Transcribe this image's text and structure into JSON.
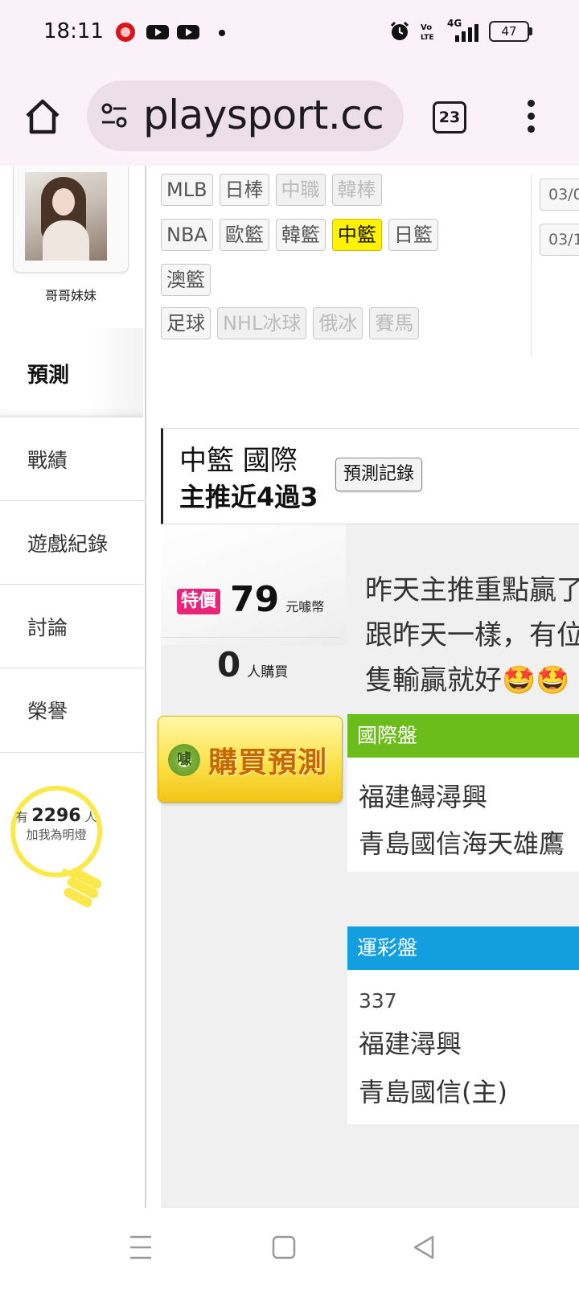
{
  "status_bar": {
    "time": "18:11",
    "network": "4G",
    "volte": "Vo LTE",
    "battery": "47",
    "icons": [
      "app-red-icon",
      "youtube-icon",
      "youtube-icon",
      "notification-dot",
      "alarm-icon",
      "volte-icon",
      "signal-icon",
      "battery-icon"
    ]
  },
  "browser": {
    "url": "playsport.cc",
    "tab_count": "23"
  },
  "sidebar": {
    "user_name": "哥哥妹妹",
    "active_item": "預測",
    "items": [
      "戰績",
      "遊戲紀錄",
      "討論",
      "榮譽"
    ],
    "followers_prefix": "有",
    "followers_count": "2296",
    "followers_suffix": "人",
    "followers_caption": "加我為明燈"
  },
  "sport_tags": {
    "row1": [
      {
        "label": "MLB",
        "state": "normal"
      },
      {
        "label": "日棒",
        "state": "normal"
      },
      {
        "label": "中職",
        "state": "dim"
      },
      {
        "label": "韓棒",
        "state": "dim"
      }
    ],
    "row2": [
      {
        "label": "NBA",
        "state": "normal"
      },
      {
        "label": "歐籃",
        "state": "normal"
      },
      {
        "label": "韓籃",
        "state": "normal"
      },
      {
        "label": "中籃",
        "state": "active"
      },
      {
        "label": "日籃",
        "state": "normal"
      }
    ],
    "row3": [
      {
        "label": "澳籃",
        "state": "normal"
      }
    ],
    "row4": [
      {
        "label": "足球",
        "state": "normal"
      },
      {
        "label": "NHL冰球",
        "state": "dim"
      },
      {
        "label": "俄冰",
        "state": "dim"
      },
      {
        "label": "賽馬",
        "state": "dim"
      }
    ]
  },
  "dates": [
    "03/0",
    "03/1"
  ],
  "prediction": {
    "title": "中籃 國際",
    "subtitle": "主推近4過3",
    "record_button": "預測記錄",
    "sale_badge": "特價",
    "price": "79",
    "price_unit": "元噱幣",
    "buyers": "0",
    "buyers_unit": "人購買",
    "buy_button": "購買預測",
    "coin_label": "噱",
    "description_lines": [
      "昨天主推重點贏了",
      "跟昨天一樣，有位",
      "隻輸贏就好🤩🤩"
    ]
  },
  "odds": {
    "international": {
      "header": "國際盤",
      "header_color": "#6cbd1c",
      "lines": [
        "福建鱘潯興",
        "青島國信海天雄鷹"
      ]
    },
    "lottery": {
      "header": "運彩盤",
      "header_color": "#139ee0",
      "code": "337",
      "lines": [
        "福建潯興",
        "青島國信(主)"
      ]
    }
  },
  "nav_icons": [
    "recent-apps-icon",
    "home-icon",
    "back-icon"
  ]
}
